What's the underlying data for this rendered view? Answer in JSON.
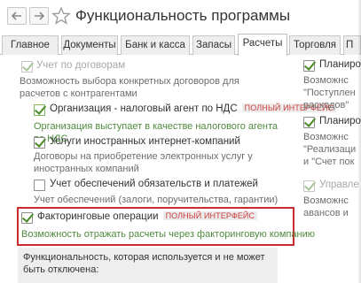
{
  "window": {
    "title": "Функциональность программы"
  },
  "nav": {
    "back_icon": "arrow-left-icon",
    "forward_icon": "arrow-right-icon",
    "favorite_icon": "star-icon"
  },
  "tabs": [
    {
      "label": "Главное",
      "active": false
    },
    {
      "label": "Документы",
      "active": false
    },
    {
      "label": "Банк и касса",
      "active": false
    },
    {
      "label": "Запасы",
      "active": false
    },
    {
      "label": "Расчеты",
      "active": true
    },
    {
      "label": "Торговля",
      "active": false
    },
    {
      "label": "П",
      "active": false
    }
  ],
  "left": {
    "contracts": {
      "label": "Учет по договорам",
      "checked": true,
      "disabled": true,
      "desc": "Возможность выбора конкретных договоров для расчетов с контрагентами"
    },
    "vat_agent": {
      "label": "Организация - налоговый агент по НДС",
      "badge": "ПОЛНЫЙ ИНТЕРФЕЙС",
      "checked": true,
      "desc": "Организация выступает в качестве налогового агента по НДС"
    },
    "foreign_services": {
      "label": "Услуги иностранных интернет-компаний",
      "checked": true,
      "desc": "Договоры на приобретение электронных услуг у иностранных компаний"
    },
    "collateral": {
      "label": "Учет обеспечений обязательств и платежей",
      "checked": false,
      "desc": "Учет обеспечений (залоги, поручительства, гарантии)"
    },
    "factoring": {
      "label": "Факторинговые операции",
      "badge": "ПОЛНЫЙ ИНТЕРФЕЙС",
      "checked": true,
      "desc": "Возможность отражать расчеты через факторинговую компанию"
    },
    "footer": "Функциональность, которая используется и не может быть отключена:"
  },
  "right": {
    "item1": {
      "label": "Планиро",
      "checked": true
    },
    "item1_desc": [
      "Возможнс",
      "\"Поступлен",
      "расходов\""
    ],
    "item2": {
      "label": "Планиро",
      "checked": true
    },
    "item2_desc": [
      "Возможнс",
      "\"Реализаци",
      "и \"Счет пок"
    ],
    "item3": {
      "label": "Управле",
      "checked": true,
      "disabled": true
    },
    "item3_desc": [
      "Возможнс",
      "авансов и"
    ]
  },
  "colors": {
    "accent_green": "#4a8a26",
    "badge_red": "#cc3b3b",
    "highlight_red": "#cc2b2b"
  }
}
